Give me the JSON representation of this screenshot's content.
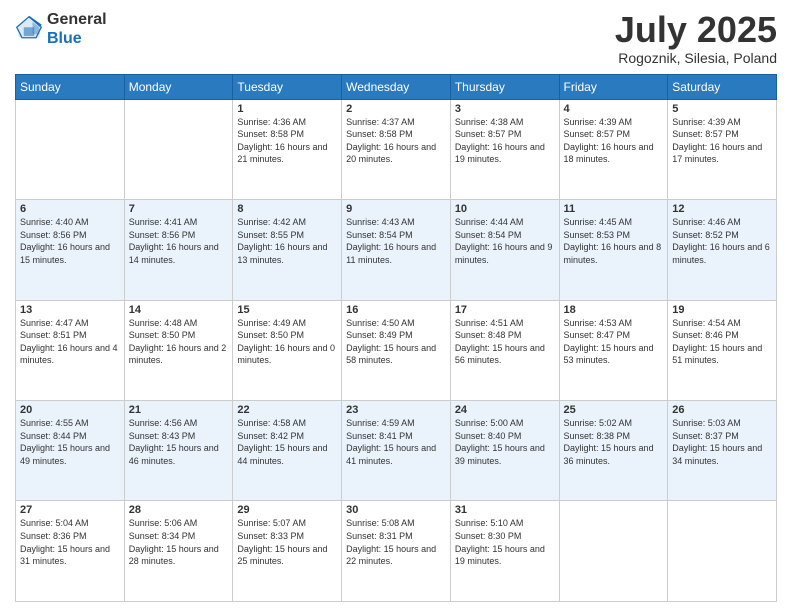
{
  "header": {
    "logo": {
      "line1": "General",
      "line2": "Blue"
    },
    "title": "July 2025",
    "subtitle": "Rogoznik, Silesia, Poland"
  },
  "weekdays": [
    "Sunday",
    "Monday",
    "Tuesday",
    "Wednesday",
    "Thursday",
    "Friday",
    "Saturday"
  ],
  "weeks": [
    {
      "days": [
        {
          "num": "",
          "info": ""
        },
        {
          "num": "",
          "info": ""
        },
        {
          "num": "1",
          "info": "Sunrise: 4:36 AM\nSunset: 8:58 PM\nDaylight: 16 hours and 21 minutes."
        },
        {
          "num": "2",
          "info": "Sunrise: 4:37 AM\nSunset: 8:58 PM\nDaylight: 16 hours and 20 minutes."
        },
        {
          "num": "3",
          "info": "Sunrise: 4:38 AM\nSunset: 8:57 PM\nDaylight: 16 hours and 19 minutes."
        },
        {
          "num": "4",
          "info": "Sunrise: 4:39 AM\nSunset: 8:57 PM\nDaylight: 16 hours and 18 minutes."
        },
        {
          "num": "5",
          "info": "Sunrise: 4:39 AM\nSunset: 8:57 PM\nDaylight: 16 hours and 17 minutes."
        }
      ]
    },
    {
      "days": [
        {
          "num": "6",
          "info": "Sunrise: 4:40 AM\nSunset: 8:56 PM\nDaylight: 16 hours and 15 minutes."
        },
        {
          "num": "7",
          "info": "Sunrise: 4:41 AM\nSunset: 8:56 PM\nDaylight: 16 hours and 14 minutes."
        },
        {
          "num": "8",
          "info": "Sunrise: 4:42 AM\nSunset: 8:55 PM\nDaylight: 16 hours and 13 minutes."
        },
        {
          "num": "9",
          "info": "Sunrise: 4:43 AM\nSunset: 8:54 PM\nDaylight: 16 hours and 11 minutes."
        },
        {
          "num": "10",
          "info": "Sunrise: 4:44 AM\nSunset: 8:54 PM\nDaylight: 16 hours and 9 minutes."
        },
        {
          "num": "11",
          "info": "Sunrise: 4:45 AM\nSunset: 8:53 PM\nDaylight: 16 hours and 8 minutes."
        },
        {
          "num": "12",
          "info": "Sunrise: 4:46 AM\nSunset: 8:52 PM\nDaylight: 16 hours and 6 minutes."
        }
      ]
    },
    {
      "days": [
        {
          "num": "13",
          "info": "Sunrise: 4:47 AM\nSunset: 8:51 PM\nDaylight: 16 hours and 4 minutes."
        },
        {
          "num": "14",
          "info": "Sunrise: 4:48 AM\nSunset: 8:50 PM\nDaylight: 16 hours and 2 minutes."
        },
        {
          "num": "15",
          "info": "Sunrise: 4:49 AM\nSunset: 8:50 PM\nDaylight: 16 hours and 0 minutes."
        },
        {
          "num": "16",
          "info": "Sunrise: 4:50 AM\nSunset: 8:49 PM\nDaylight: 15 hours and 58 minutes."
        },
        {
          "num": "17",
          "info": "Sunrise: 4:51 AM\nSunset: 8:48 PM\nDaylight: 15 hours and 56 minutes."
        },
        {
          "num": "18",
          "info": "Sunrise: 4:53 AM\nSunset: 8:47 PM\nDaylight: 15 hours and 53 minutes."
        },
        {
          "num": "19",
          "info": "Sunrise: 4:54 AM\nSunset: 8:46 PM\nDaylight: 15 hours and 51 minutes."
        }
      ]
    },
    {
      "days": [
        {
          "num": "20",
          "info": "Sunrise: 4:55 AM\nSunset: 8:44 PM\nDaylight: 15 hours and 49 minutes."
        },
        {
          "num": "21",
          "info": "Sunrise: 4:56 AM\nSunset: 8:43 PM\nDaylight: 15 hours and 46 minutes."
        },
        {
          "num": "22",
          "info": "Sunrise: 4:58 AM\nSunset: 8:42 PM\nDaylight: 15 hours and 44 minutes."
        },
        {
          "num": "23",
          "info": "Sunrise: 4:59 AM\nSunset: 8:41 PM\nDaylight: 15 hours and 41 minutes."
        },
        {
          "num": "24",
          "info": "Sunrise: 5:00 AM\nSunset: 8:40 PM\nDaylight: 15 hours and 39 minutes."
        },
        {
          "num": "25",
          "info": "Sunrise: 5:02 AM\nSunset: 8:38 PM\nDaylight: 15 hours and 36 minutes."
        },
        {
          "num": "26",
          "info": "Sunrise: 5:03 AM\nSunset: 8:37 PM\nDaylight: 15 hours and 34 minutes."
        }
      ]
    },
    {
      "days": [
        {
          "num": "27",
          "info": "Sunrise: 5:04 AM\nSunset: 8:36 PM\nDaylight: 15 hours and 31 minutes."
        },
        {
          "num": "28",
          "info": "Sunrise: 5:06 AM\nSunset: 8:34 PM\nDaylight: 15 hours and 28 minutes."
        },
        {
          "num": "29",
          "info": "Sunrise: 5:07 AM\nSunset: 8:33 PM\nDaylight: 15 hours and 25 minutes."
        },
        {
          "num": "30",
          "info": "Sunrise: 5:08 AM\nSunset: 8:31 PM\nDaylight: 15 hours and 22 minutes."
        },
        {
          "num": "31",
          "info": "Sunrise: 5:10 AM\nSunset: 8:30 PM\nDaylight: 15 hours and 19 minutes."
        },
        {
          "num": "",
          "info": ""
        },
        {
          "num": "",
          "info": ""
        }
      ]
    }
  ]
}
